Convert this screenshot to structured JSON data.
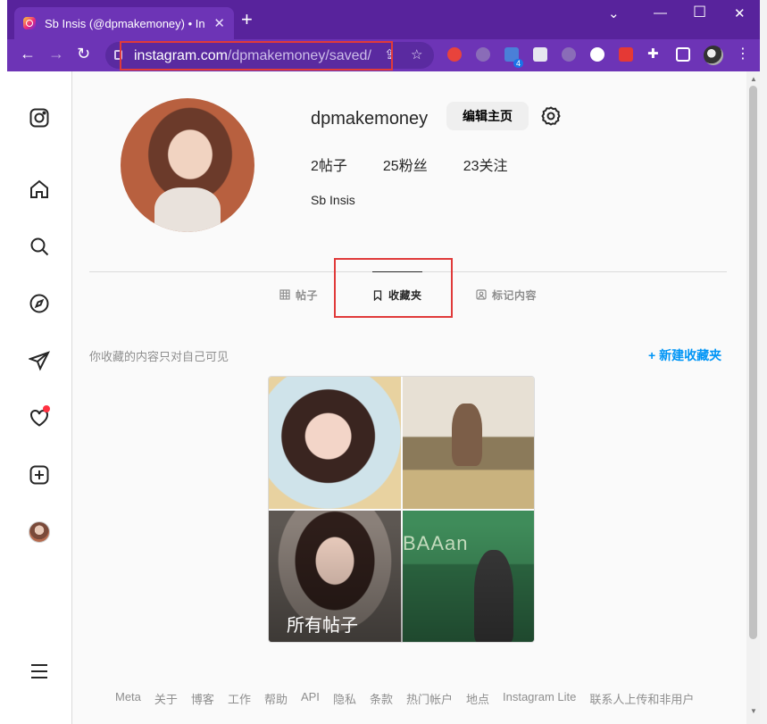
{
  "browser": {
    "tab_title": "Sb Insis (@dpmakemoney) • In",
    "new_tab": "+",
    "url_host": "instagram.com",
    "url_path": "/dpmakemoney/saved/",
    "extension_badge": "4",
    "accent_color": "#6d34b6",
    "highlight_color": "#e03a3a"
  },
  "sidebar": {
    "icons": [
      "instagram-icon",
      "home-icon",
      "search-icon",
      "explore-icon",
      "messages-icon",
      "notifications-icon",
      "create-icon",
      "profile-avatar",
      "menu-icon"
    ]
  },
  "profile": {
    "username": "dpmakemoney",
    "edit_label": "编辑主页",
    "stats": [
      {
        "label": "2帖子"
      },
      {
        "label": "25粉丝"
      },
      {
        "label": "23关注"
      }
    ],
    "full_name": "Sb Insis"
  },
  "tabs": [
    {
      "label": "帖子",
      "active": false
    },
    {
      "label": "收藏夹",
      "active": true
    },
    {
      "label": "标记内容",
      "active": false
    }
  ],
  "saved": {
    "hint": "你收藏的内容只对自己可见",
    "new_collection": "+ 新建收藏夹",
    "collection_label": "所有帖子"
  },
  "footer": [
    "Meta",
    "关于",
    "博客",
    "工作",
    "帮助",
    "API",
    "隐私",
    "条款",
    "热门帐户",
    "地点",
    "Instagram Lite",
    "联系人上传和非用户"
  ]
}
